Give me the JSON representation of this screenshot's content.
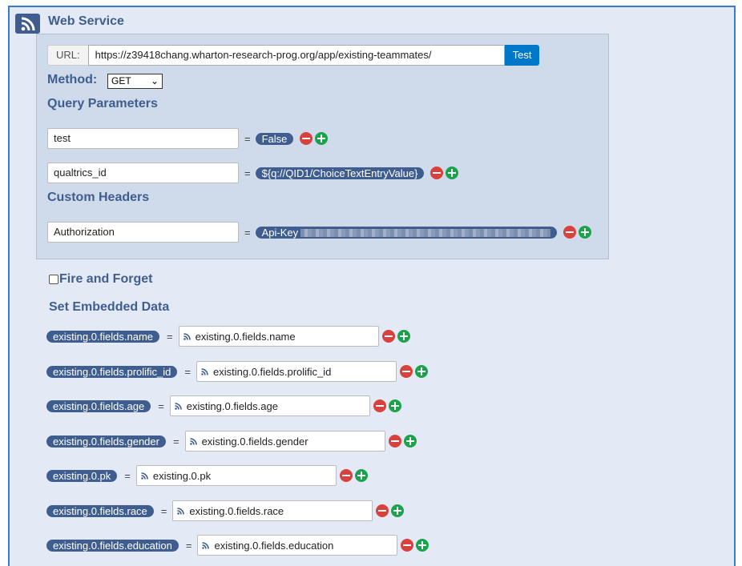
{
  "title": "Web Service",
  "url": {
    "label": "URL:",
    "value": "https://z39418chang.wharton-research-prog.org/app/existing-teammates/",
    "test_label": "Test"
  },
  "method": {
    "label": "Method:",
    "value": "GET"
  },
  "query": {
    "heading": "Query Parameters",
    "rows": [
      {
        "key": "test",
        "value": "False"
      },
      {
        "key": "qualtrics_id",
        "value": "${q://QID1/ChoiceTextEntryValue}"
      }
    ]
  },
  "headers": {
    "heading": "Custom Headers",
    "rows": [
      {
        "key": "Authorization",
        "value": "Api-Key"
      }
    ]
  },
  "fire_and_forget": {
    "label": "Fire and Forget",
    "checked": false
  },
  "embedded": {
    "heading": "Set Embedded Data",
    "rows": [
      {
        "name": "existing.0.fields.name",
        "value": "existing.0.fields.name"
      },
      {
        "name": "existing.0.fields.prolific_id",
        "value": "existing.0.fields.prolific_id"
      },
      {
        "name": "existing.0.fields.age",
        "value": "existing.0.fields.age"
      },
      {
        "name": "existing.0.fields.gender",
        "value": "existing.0.fields.gender"
      },
      {
        "name": "existing.0.pk",
        "value": "existing.0.pk"
      },
      {
        "name": "existing.0.fields.race",
        "value": "existing.0.fields.race"
      },
      {
        "name": "existing.0.fields.education",
        "value": "existing.0.fields.education"
      }
    ]
  },
  "eq": "=",
  "colors": {
    "accent": "#3f5e8f",
    "button": "#0077c8",
    "remove": "#d9413f",
    "add": "#1aa34a"
  }
}
